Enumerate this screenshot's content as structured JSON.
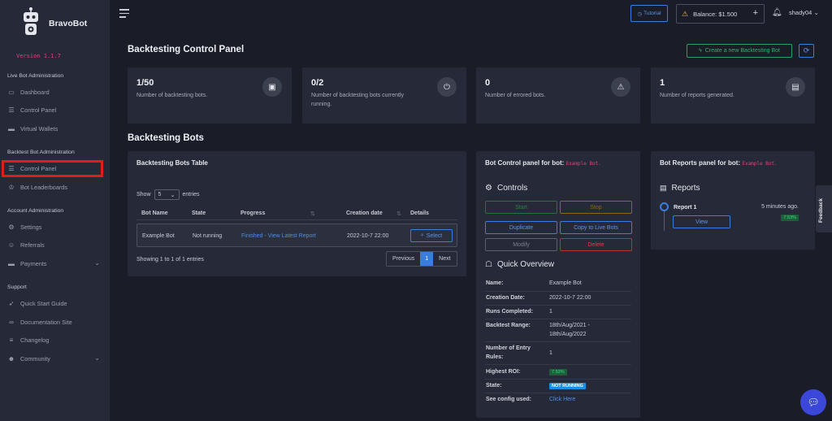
{
  "brand": {
    "name": "BravoBot",
    "version": "Version 1.1.7"
  },
  "sidebar": {
    "sections": [
      {
        "title": "Live Bot Administration",
        "items": [
          {
            "label": "Dashboard",
            "icon": "monitor-icon"
          },
          {
            "label": "Control Panel",
            "icon": "sliders-icon"
          },
          {
            "label": "Virtual Wallets",
            "icon": "wallet-icon"
          }
        ]
      },
      {
        "title": "Backtest Bot Administration",
        "items": [
          {
            "label": "Control Panel",
            "icon": "sliders-icon"
          },
          {
            "label": "Bot Leaderboards",
            "icon": "trophy-icon"
          }
        ]
      },
      {
        "title": "Account Administration",
        "items": [
          {
            "label": "Settings",
            "icon": "user-gear-icon"
          },
          {
            "label": "Referrals",
            "icon": "users-icon"
          },
          {
            "label": "Payments",
            "icon": "wallet-icon"
          }
        ]
      },
      {
        "title": "Support",
        "items": [
          {
            "label": "Quick Start Guide",
            "icon": "rocket-icon"
          },
          {
            "label": "Documentation Site",
            "icon": "link-icon"
          },
          {
            "label": "Changelog",
            "icon": "list-icon"
          },
          {
            "label": "Community",
            "icon": "people-icon"
          }
        ]
      }
    ]
  },
  "topbar": {
    "tutorial": "Tutorial",
    "balance": "Balance: $1.500",
    "user": "shady04"
  },
  "page": {
    "title": "Backtesting Control Panel",
    "create_button": "Create a new Backtesting Bot",
    "section_title": "Backtesting Bots"
  },
  "stats": [
    {
      "value": "1/50",
      "label": "Number of backtesting bots.",
      "icon": "chip-icon"
    },
    {
      "value": "0/2",
      "label": "Number of backtesting bots currently running.",
      "icon": "power-icon"
    },
    {
      "value": "0",
      "label": "Number of errored bots.",
      "icon": "warning-icon"
    },
    {
      "value": "1",
      "label": "Number of reports generated.",
      "icon": "document-icon"
    }
  ],
  "table": {
    "title": "Backtesting Bots Table",
    "show": "Show",
    "entries": "entries",
    "page_size": "5",
    "headers": [
      "Bot Name",
      "State",
      "Progress",
      "Creation date",
      "Details"
    ],
    "rows": [
      {
        "name": "Example Bot",
        "state": "Not running",
        "progress": "Finished - View Latest Report",
        "date": "2022-10-7 22:00",
        "action": "Select"
      }
    ],
    "info": "Showing 1 to 1 of 1 entries",
    "pager": {
      "prev": "Previous",
      "page": "1",
      "next": "Next"
    }
  },
  "control": {
    "title": "Bot Control panel for bot:",
    "bot": "Example Bot.",
    "controls_title": "Controls",
    "buttons": {
      "start": "Start",
      "stop": "Stop",
      "duplicate": "Duplicate",
      "copy": "Copy to Live Bots",
      "modify": "Modify",
      "delete": "Delete"
    },
    "overview_title": "Quick Overview",
    "overview": [
      {
        "k": "Name:",
        "v": "Example Bot"
      },
      {
        "k": "Creation Date:",
        "v": "2022-10-7 22:00"
      },
      {
        "k": "Runs Completed:",
        "v": "1"
      },
      {
        "k": "Backtest Range:",
        "v": "18th/Aug/2021 - 18th/Aug/2022"
      },
      {
        "k": "Number of Entry Rules:",
        "v": "1"
      },
      {
        "k": "Highest ROI:",
        "v": "7.53%"
      },
      {
        "k": "State:",
        "v": "NOT RUNNING"
      },
      {
        "k": "See config used:",
        "v": "Click Here"
      }
    ]
  },
  "reports": {
    "title": "Bot Reports panel for bot:",
    "bot": "Example Bot.",
    "heading": "Reports",
    "items": [
      {
        "name": "Report 1",
        "time": "5 minutes ago.",
        "roi": "7.53%",
        "action": "View"
      }
    ]
  },
  "feedback": "Feedback",
  "colors": {
    "accent": "#3b7ddd",
    "success": "#28a060",
    "danger": "#d94040",
    "warning": "#f5b823",
    "highlight": "#e01d1d"
  }
}
